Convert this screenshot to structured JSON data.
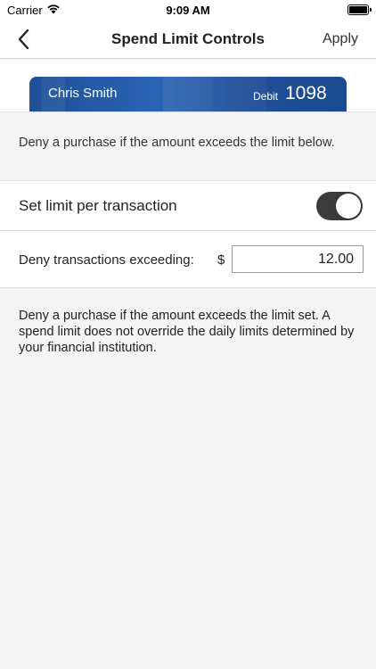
{
  "status_bar": {
    "carrier": "Carrier",
    "time": "9:09 AM"
  },
  "nav": {
    "title": "Spend Limit Controls",
    "apply_label": "Apply"
  },
  "card": {
    "holder_name": "Chris Smith",
    "type": "Debit",
    "last4": "1098"
  },
  "intro_text": "Deny a purchase if the amount exceeds the limit below.",
  "toggle_row": {
    "label": "Set limit per transaction",
    "enabled": true
  },
  "limit_row": {
    "label": "Deny transactions exceeding:",
    "currency_symbol": "$",
    "value": "12.00"
  },
  "note_text": "Deny a purchase if the amount exceeds the limit set. A spend limit does not override the daily limits determined by your financial institution.",
  "colors": {
    "toggle_on": "#3b3b3b",
    "card_blue": "#2a64b4",
    "background": "#f4f4f4"
  }
}
